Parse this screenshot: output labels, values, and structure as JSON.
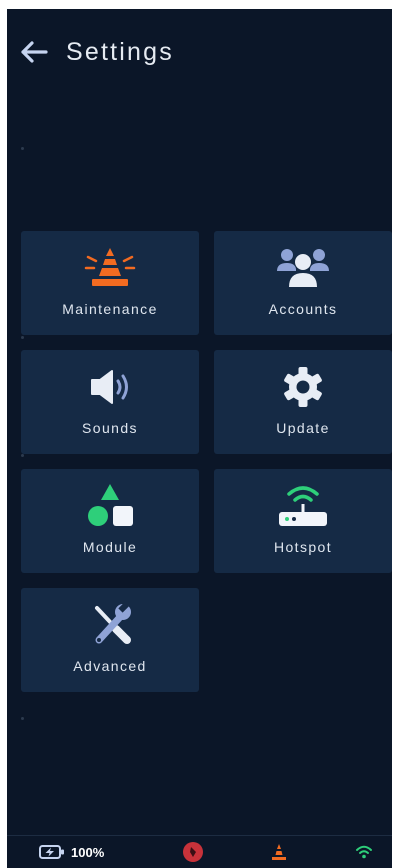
{
  "header": {
    "title": "Settings",
    "back_icon": "arrow-left-icon"
  },
  "tiles": [
    {
      "id": "maintenance",
      "label": "Maintenance",
      "icon": "traffic-cone-icon"
    },
    {
      "id": "accounts",
      "label": "Accounts",
      "icon": "users-icon"
    },
    {
      "id": "sounds",
      "label": "Sounds",
      "icon": "speaker-icon"
    },
    {
      "id": "update",
      "label": "Update",
      "icon": "gear-icon"
    },
    {
      "id": "module",
      "label": "Module",
      "icon": "shapes-icon"
    },
    {
      "id": "hotspot",
      "label": "Hotspot",
      "icon": "router-wifi-icon"
    },
    {
      "id": "advanced",
      "label": "Advanced",
      "icon": "tools-icon"
    }
  ],
  "status_bar": {
    "battery_level": "100%",
    "battery_icon": "battery-charging-icon",
    "compass_icon": "compass-icon",
    "cone_icon": "traffic-cone-icon",
    "wifi_icon": "wifi-icon"
  },
  "colors": {
    "background": "#0b1628",
    "tile": "#152a45",
    "cone": "#f26b21",
    "user": "#8fa3d6",
    "speaker": "#e8edf5",
    "gear": "#e8edf5",
    "green": "#2ecf7a",
    "tools": "#8fa3d6",
    "compass": "#c8323a"
  }
}
